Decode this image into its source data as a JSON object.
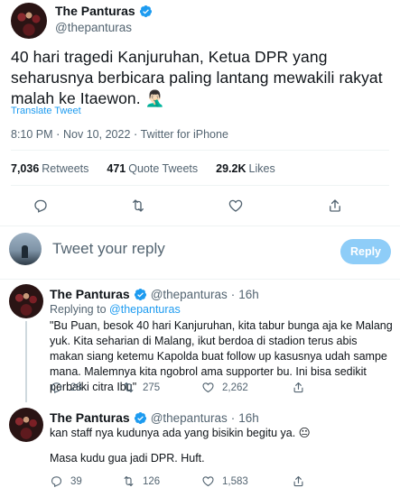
{
  "main_tweet": {
    "display_name": "The Panturas",
    "handle": "@thepanturas",
    "text": "40 hari tragedi Kanjuruhan, Ketua DPR yang seharusnya berbicara paling lantang mewakili rakyat malah ke Itaewon. 🤦🏻‍♂️",
    "translate_label": "Translate Tweet",
    "time": "8:10 PM",
    "date": "Nov 10, 2022",
    "source": "Twitter for iPhone",
    "retweets_count": "7,036",
    "retweets_label": "Retweets",
    "quotes_count": "471",
    "quotes_label": "Quote Tweets",
    "likes_count": "29.2K",
    "likes_label": "Likes"
  },
  "compose": {
    "placeholder": "Tweet your reply",
    "reply_button": "Reply"
  },
  "replies": [
    {
      "display_name": "The Panturas",
      "handle": "@thepanturas",
      "time": "16h",
      "replying_prefix": "Replying to",
      "replying_to": "@thepanturas",
      "text": "\"Bu Puan, besok 40 hari Kanjuruhan, kita tabur bunga aja ke Malang yuk. Kita seharian di Malang, ikut berdoa di stadion terus abis makan siang ketemu Kapolda buat follow up kasusnya udah sampe mana. Malemnya kita ngobrol ama supporter bu. Ini bisa sedikit perbaiki citra Ibu\"",
      "replies": "28",
      "retweets": "275",
      "likes": "2,262"
    },
    {
      "display_name": "The Panturas",
      "handle": "@thepanturas",
      "time": "16h",
      "text1": "kan staff nya kudunya ada yang bisikin begitu ya. 😐",
      "text2": "Masa kudu gua jadi DPR. Huft.",
      "replies": "39",
      "retweets": "126",
      "likes": "1,583"
    }
  ],
  "colors": {
    "accent": "#1d9bf0",
    "text_primary": "#0f1419",
    "text_secondary": "#536471",
    "reply_button_disabled": "#8ecdf8"
  },
  "icons": [
    "verified-badge-icon",
    "reply-icon",
    "retweet-icon",
    "like-icon",
    "share-icon"
  ]
}
